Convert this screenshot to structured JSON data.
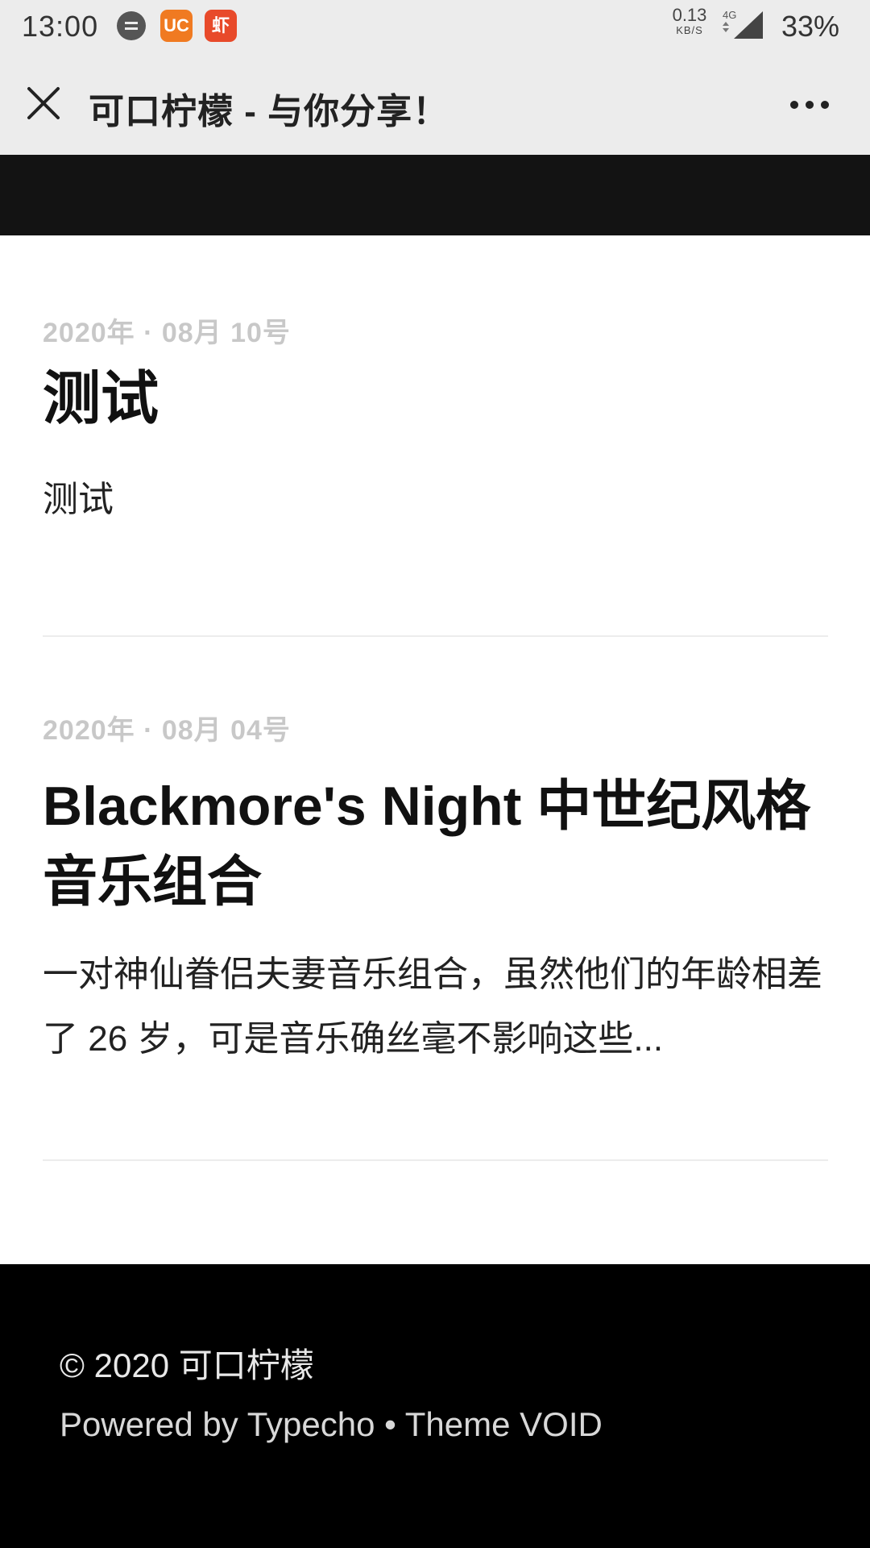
{
  "status_bar": {
    "time": "13:00",
    "apps": [
      {
        "icon": "message-icon",
        "color": "#555555"
      },
      {
        "icon": "uc-browser-icon",
        "label": "UC",
        "color": "#f07a21"
      },
      {
        "icon": "xiami-music-icon",
        "label": "虾",
        "color": "#e84a2a"
      }
    ],
    "net_speed": "0.13",
    "net_speed_unit": "KB/S",
    "network": "4G",
    "battery": "33%"
  },
  "app_bar": {
    "title": "可口柠檬 - 与你分享！",
    "close_icon": "close-icon",
    "more_icon": "more-icon"
  },
  "posts": [
    {
      "date": "2020年 · 08月 10号",
      "title": "测试",
      "excerpt": "测试"
    },
    {
      "date": "2020年 · 08月 04号",
      "title": "Blackmore's Night 中世纪风格音乐组合",
      "excerpt": "一对神仙眷侣夫妻音乐组合，虽然他们的年龄相差了 26 岁，可是音乐确丝毫不影响这些..."
    }
  ],
  "footer": {
    "copyright": "© 2020 可口柠檬",
    "powered_prefix": "Powered by ",
    "typecho_link": "Typecho",
    "separator": " • ",
    "theme_link": "Theme VOID"
  },
  "colors": {
    "status_bar_bg": "#ececec",
    "header_band": "#131313",
    "footer_bg": "#000000",
    "date_text": "#c8c8c8"
  }
}
